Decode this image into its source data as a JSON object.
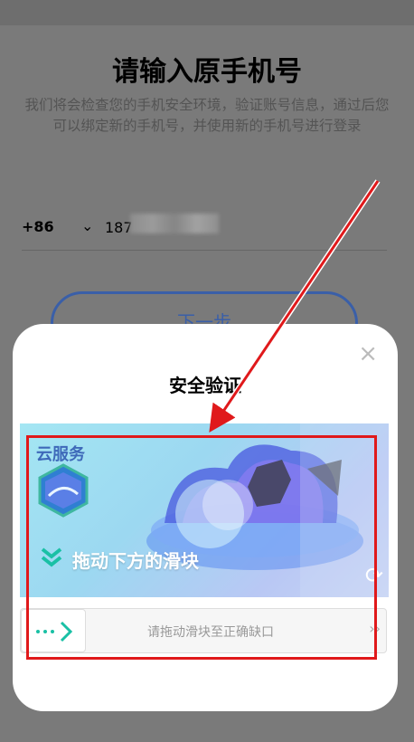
{
  "page": {
    "title": "请输入原手机号",
    "description": "我们将会检查您的手机安全环境，验证账号信息，通过后您可以绑定新的手机号，并使用新的手机号进行登录",
    "country_code": "+86",
    "phone_prefix": "187",
    "next_button": "下一步"
  },
  "dialog": {
    "title": "安全验证",
    "close_icon": "×",
    "captcha": {
      "brand": "云服务",
      "hint": "拖动下方的滑块",
      "refresh_icon": "⟳"
    },
    "slider": {
      "handle_icon": "arrow-right-icon",
      "text": "请拖动滑块至正确缺口",
      "end_icon": "››"
    }
  },
  "colors": {
    "accent": "#3a5fa8",
    "annotation": "#e0191b",
    "teal": "#19c0a5"
  }
}
